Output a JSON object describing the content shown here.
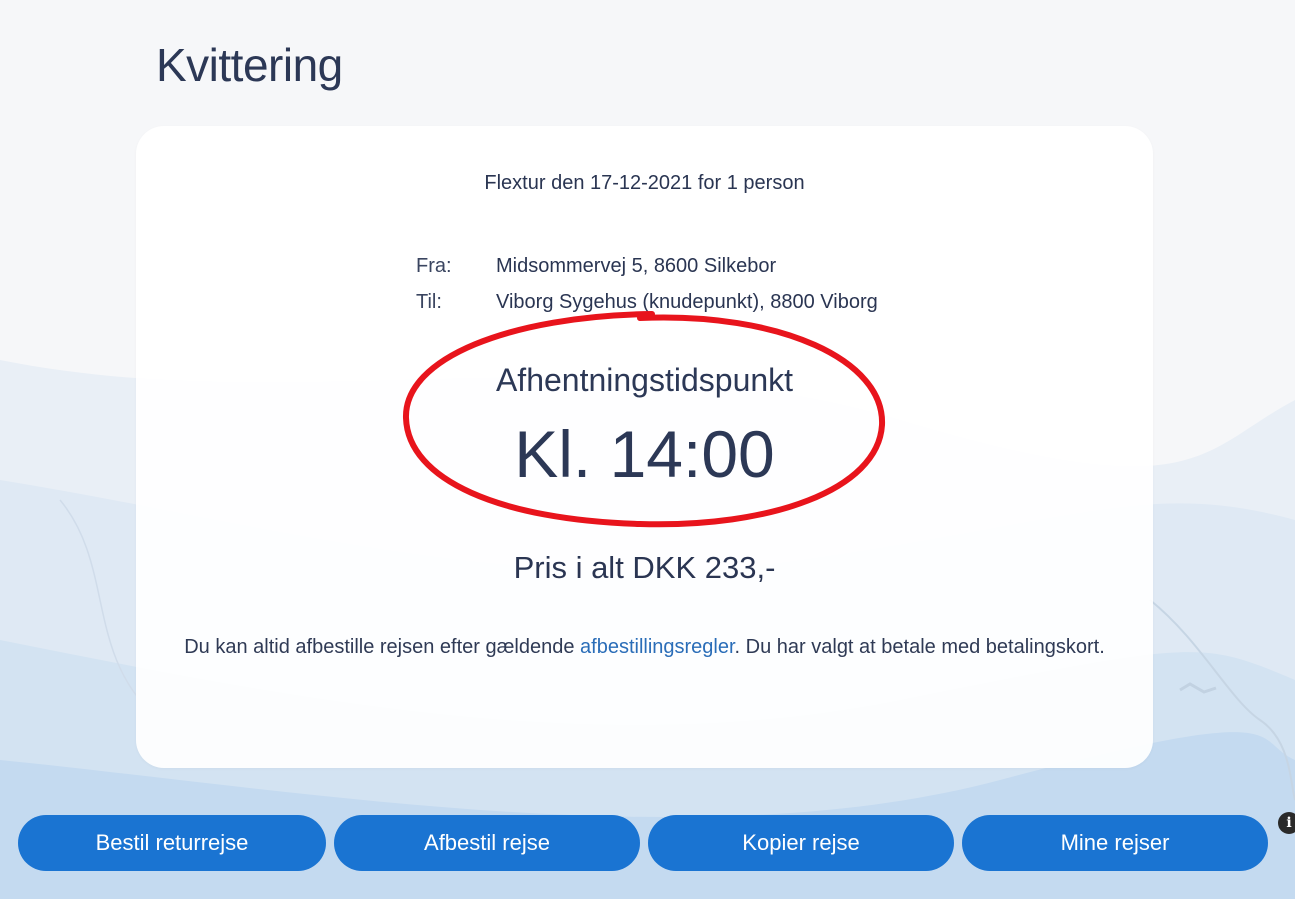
{
  "page": {
    "title": "Kvittering"
  },
  "receipt": {
    "trip_summary": "Flextur den 17-12-2021 for 1 person",
    "from_label": "Fra:",
    "from_value": "Midsommervej 5, 8600 Silkebor",
    "to_label": "Til:",
    "to_value": "Viborg Sygehus (knudepunkt), 8800 Viborg",
    "pickup_label": "Afhentningstidspunkt",
    "pickup_time": "Kl. 14:00",
    "price": "Pris i alt DKK 233,-",
    "info_text_before": "Du kan altid afbestille rejsen efter gældende ",
    "info_link": "afbestillingsregler",
    "info_text_after": ". Du har valgt at betale med betalingskort."
  },
  "actions": {
    "return_trip": "Bestil returrejse",
    "cancel_trip": "Afbestil rejse",
    "copy_trip": "Kopier rejse",
    "my_trips": "Mine rejser"
  },
  "icons": {
    "info": "info-icon"
  },
  "colors": {
    "button": "#1a74d2",
    "link": "#2a6db8",
    "text": "#2a3552",
    "annotation": "#e8141c"
  }
}
